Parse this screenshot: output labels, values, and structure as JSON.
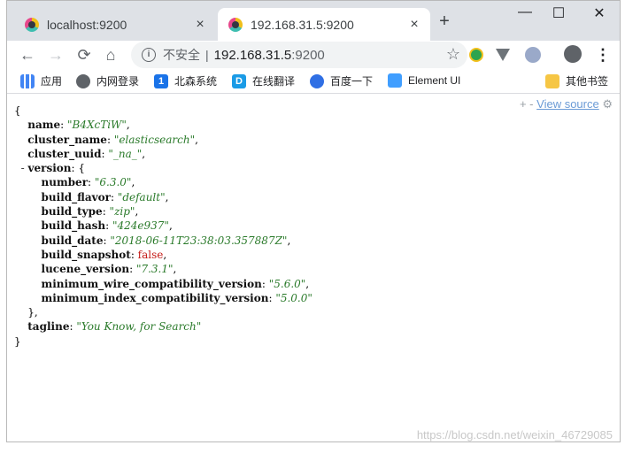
{
  "tabs": [
    {
      "title": "localhost:9200",
      "close": "×"
    },
    {
      "title": "192.168.31.5:9200",
      "close": "×"
    }
  ],
  "new_tab": "+",
  "window_controls": {
    "minimize": "—",
    "maximize": "☐",
    "close": "✕"
  },
  "toolbar": {
    "back": "←",
    "forward": "→",
    "reload": "⟳",
    "home": "⌂",
    "security_label": "不安全",
    "separator": "|",
    "url_host": "192.168.31.5",
    "url_port": ":9200",
    "star": "☆",
    "menu": "⋮"
  },
  "bookmarks": [
    {
      "label": "应用",
      "icon": "apps-grid-icon"
    },
    {
      "label": "内网登录",
      "icon": "globe-icon"
    },
    {
      "label": "北森系统",
      "icon": "beisen-icon"
    },
    {
      "label": "在线翻译",
      "icon": "translate-icon"
    },
    {
      "label": "百度一下",
      "icon": "baidu-paw-icon"
    },
    {
      "label": "Element UI",
      "icon": "element-ui-icon"
    }
  ],
  "other_bookmarks": "其他书签",
  "jsonview": {
    "plus": "+",
    "minus": "-",
    "view_source": "View source"
  },
  "json": {
    "open_brace": "{",
    "close_brace": "}",
    "name_key": "name",
    "name_val": "\"B4XcTiW\"",
    "cluster_name_key": "cluster_name",
    "cluster_name_val": "\"elasticsearch\"",
    "cluster_uuid_key": "cluster_uuid",
    "cluster_uuid_val": "\"_na_\"",
    "version_toggle": "-",
    "version_key": "version",
    "version_open": "{",
    "number_key": "number",
    "number_val": "\"6.3.0\"",
    "build_flavor_key": "build_flavor",
    "build_flavor_val": "\"default\"",
    "build_type_key": "build_type",
    "build_type_val": "\"zip\"",
    "build_hash_key": "build_hash",
    "build_hash_val": "\"424e937\"",
    "build_date_key": "build_date",
    "build_date_val": "\"2018-06-11T23:38:03.357887Z\"",
    "build_snapshot_key": "build_snapshot",
    "build_snapshot_val": "false",
    "lucene_version_key": "lucene_version",
    "lucene_version_val": "\"7.3.1\"",
    "min_wire_key": "minimum_wire_compatibility_version",
    "min_wire_val": "\"5.6.0\"",
    "min_index_key": "minimum_index_compatibility_version",
    "min_index_val": "\"5.0.0\"",
    "version_close": "},",
    "tagline_key": "tagline",
    "tagline_val": "\"You Know, for Search\""
  },
  "watermark": "https://blog.csdn.net/weixin_46729085"
}
